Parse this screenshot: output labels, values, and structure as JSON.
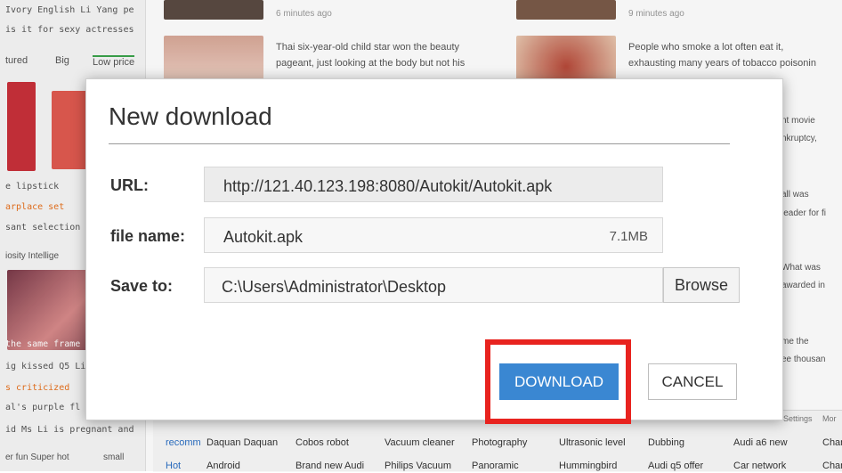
{
  "background": {
    "left_lines": [
      "Ivory English Li Yang pe",
      "is it for sexy actresses",
      "e lipstick",
      "arplace set",
      "sant selection",
      "iosity Intellige",
      "the same frame",
      "ig kissed Q5 Li",
      "s criticized",
      "al's purple fl",
      "id Ms Li is pregnant and",
      "er fun Super hot"
    ],
    "left_tabs": [
      "tured",
      "Big",
      "Low price"
    ],
    "left_small_tab": "small",
    "news": [
      {
        "time": "6 minutes ago"
      },
      {
        "time": "9 minutes ago"
      },
      {
        "text1": "Thai six-year-old child star won the beauty",
        "text2": "pageant, just looking at the body but not his"
      },
      {
        "text1": "People who smoke a lot often eat it,",
        "text2": "exhausting many years of tobacco poisonin"
      }
    ],
    "side_snippets": [
      "nt movie",
      "nkruptcy,",
      "all was",
      "leader for fi",
      "What was",
      "awarded in",
      "me the",
      "ee thousan"
    ],
    "bottom": {
      "row1_label": "recomm",
      "row1": [
        "Daquan Daquan",
        "Cobos robot",
        "Vacuum cleaner",
        "Photography",
        "Ultrasonic level",
        "Dubbing",
        "Audi a6 new",
        "Char"
      ],
      "row2_label": "Hot",
      "row2": [
        "Android",
        "Brand new Audi",
        "Philips Vacuum",
        "Panoramic",
        "Hummingbird",
        "Audi q5 offer",
        "Car network",
        "Char"
      ],
      "settings": "Settings",
      "more": "Mor"
    }
  },
  "dialog": {
    "title": "New download",
    "url_label": "URL:",
    "url_value": "http://121.40.123.198:8080/Autokit/Autokit.apk",
    "filename_label": "file name:",
    "filename_value": "Autokit.apk",
    "filesize": "7.1MB",
    "saveto_label": "Save to:",
    "saveto_value": "C:\\Users\\Administrator\\Desktop",
    "browse_label": "Browse",
    "download_label": "DOWNLOAD",
    "cancel_label": "CANCEL",
    "colors": {
      "download_button": "#3a87d2",
      "highlight_box": "#e8231f"
    }
  }
}
